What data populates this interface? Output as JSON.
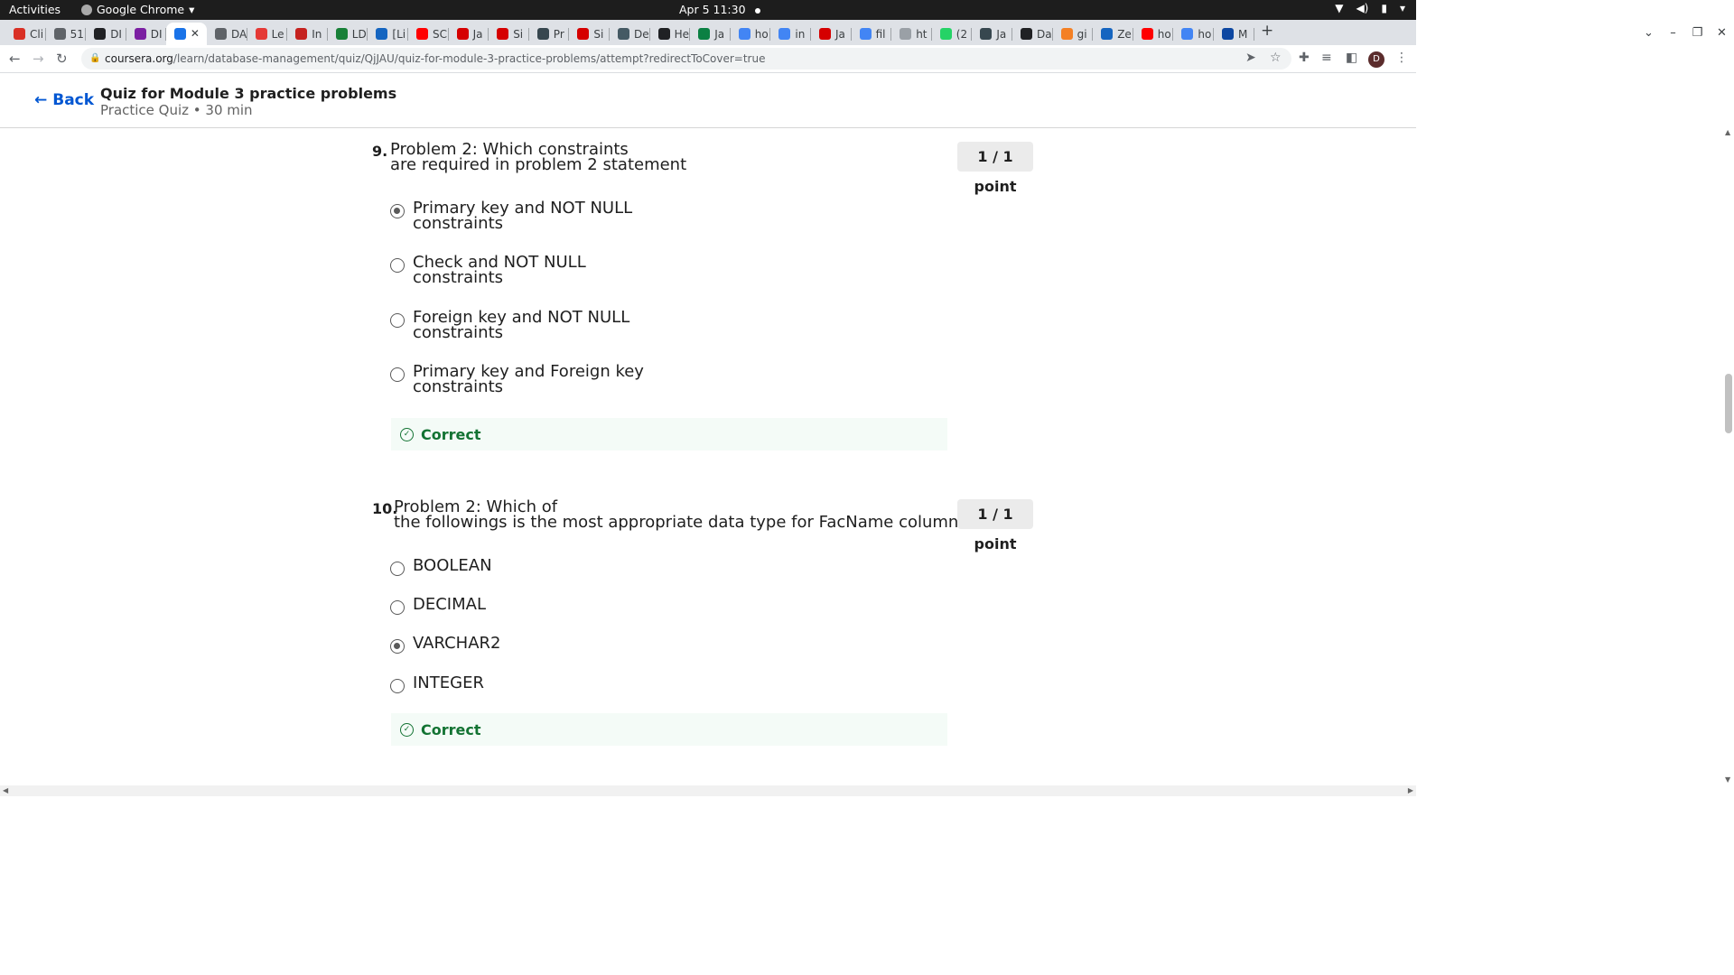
{
  "system_bar": {
    "activities": "Activities",
    "app_name": "Google Chrome",
    "app_menu_arrow": "▾",
    "clock": "Apr 5  11:30"
  },
  "tabs": [
    {
      "label": "Cli",
      "color": "#d93025"
    },
    {
      "label": "51",
      "color": "#5f6368"
    },
    {
      "label": "DI",
      "color": "#202124"
    },
    {
      "label": "DI",
      "color": "#7b1fa2"
    },
    {
      "label": "",
      "color": "#1a73e8",
      "active": true
    },
    {
      "label": "DA",
      "color": "#5f6368"
    },
    {
      "label": "Le",
      "color": "#e53935"
    },
    {
      "label": "In",
      "color": "#c5221f"
    },
    {
      "label": "LD",
      "color": "#188038"
    },
    {
      "label": "[Li",
      "color": "#1565c0"
    },
    {
      "label": "SC",
      "color": "#ff0000"
    },
    {
      "label": "Ja",
      "color": "#d50000"
    },
    {
      "label": "Si",
      "color": "#d50000"
    },
    {
      "label": "Pr",
      "color": "#37474f"
    },
    {
      "label": "Si",
      "color": "#d50000"
    },
    {
      "label": "De",
      "color": "#455a64"
    },
    {
      "label": "He",
      "color": "#202124"
    },
    {
      "label": "Ja",
      "color": "#0b8043"
    },
    {
      "label": "ho",
      "color": "#4285f4"
    },
    {
      "label": "in",
      "color": "#4285f4"
    },
    {
      "label": "Ja",
      "color": "#d50000"
    },
    {
      "label": "fil",
      "color": "#4285f4"
    },
    {
      "label": "ht",
      "color": "#9aa0a6"
    },
    {
      "label": "(2",
      "color": "#25d366"
    },
    {
      "label": "Ja",
      "color": "#37474f"
    },
    {
      "label": "Da",
      "color": "#202124"
    },
    {
      "label": "gi",
      "color": "#f48024"
    },
    {
      "label": "Ze",
      "color": "#1565c0"
    },
    {
      "label": "ho",
      "color": "#ff0000"
    },
    {
      "label": "ho",
      "color": "#4285f4"
    },
    {
      "label": "M",
      "color": "#0d47a1"
    }
  ],
  "address_bar": {
    "host": "coursera.org",
    "path": "/learn/database-management/quiz/QjJAU/quiz-for-module-3-practice-problems/attempt?redirectToCover=true",
    "avatar_letter": "D"
  },
  "header": {
    "back_label": "Back",
    "title": "Quiz for Module 3 practice problems",
    "subtitle": "Practice Quiz • 30 min"
  },
  "questions": [
    {
      "number": "9.",
      "text_line1": "Problem 2: Which constraints",
      "text_line2": "are required in problem 2 statement",
      "points": "1 / 1 point",
      "options": [
        {
          "line1": "Primary key and NOT NULL",
          "line2": "constraints",
          "selected": true
        },
        {
          "line1": "Check and NOT NULL",
          "line2": "constraints",
          "selected": false
        },
        {
          "line1": "Foreign key and NOT NULL",
          "line2": "constraints",
          "selected": false
        },
        {
          "line1": "Primary key and Foreign key",
          "line2": "constraints",
          "selected": false
        }
      ],
      "feedback": "Correct"
    },
    {
      "number": "10.",
      "text_line1": "Problem 2: Which of",
      "text_line2": "the followings is the most appropriate data type for FacName column:",
      "points": "1 / 1 point",
      "options": [
        {
          "line1": "BOOLEAN",
          "selected": false
        },
        {
          "line1": "DECIMAL",
          "selected": false
        },
        {
          "line1": "VARCHAR2",
          "selected": true
        },
        {
          "line1": "INTEGER",
          "selected": false
        }
      ],
      "feedback": "Correct"
    }
  ]
}
